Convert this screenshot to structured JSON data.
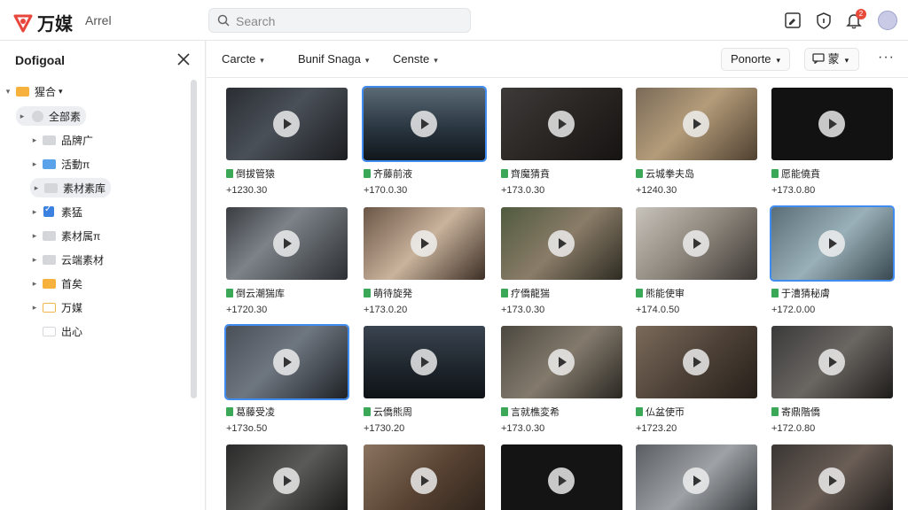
{
  "app": {
    "logo_text": "万媒",
    "name": "Arrel",
    "brand_color": "#e8463c"
  },
  "search": {
    "placeholder": "Search",
    "value": ""
  },
  "header_icons": [
    "edit-icon",
    "info-icon",
    "bell-icon",
    "avatar"
  ],
  "notifications": {
    "count": "2"
  },
  "sidebar": {
    "title": "Dofigoal",
    "tree": [
      {
        "label": "猩合",
        "icon": "folder-orange",
        "level": 0,
        "expanded": true
      },
      {
        "label": "全部素",
        "icon": "dot-gray",
        "level": 1,
        "highlighted": true
      },
      {
        "label": "品牌广",
        "icon": "folder-gray",
        "level": 2
      },
      {
        "label": "活動π",
        "icon": "folder-blue",
        "level": 2
      },
      {
        "label": "素材素库",
        "icon": "folder-gray",
        "level": 2,
        "highlighted": true
      },
      {
        "label": "素猛",
        "icon": "checkbox",
        "level": 2,
        "checked": true
      },
      {
        "label": "素材属π",
        "icon": "folder-gray",
        "level": 2
      },
      {
        "label": "云端素材",
        "icon": "folder-gray",
        "level": 2
      },
      {
        "label": "首矣",
        "icon": "folder-orange",
        "level": 2
      },
      {
        "label": "万媒",
        "icon": "folder-orange",
        "level": 2
      },
      {
        "label": "出心",
        "icon": "folder-outline",
        "level": 2
      }
    ]
  },
  "toolbar": {
    "filters": [
      "Carcte",
      "Bunif Snaga",
      "Censte"
    ],
    "sort_label": "Ponorte",
    "view_label": "蒙",
    "more_label": "···"
  },
  "videos": [
    {
      "title": "倒拔管猿",
      "meta": "+1230.30"
    },
    {
      "title": "齐藤前液",
      "meta": "+170.0.30"
    },
    {
      "title": "齊魔猜賁",
      "meta": "+173.0.30"
    },
    {
      "title": "云城拳夫岛",
      "meta": "+1240.30"
    },
    {
      "title": "愿能僥賁",
      "meta": "+173.0.80"
    },
    {
      "title": "倒云潮猯库",
      "meta": "+1720.30"
    },
    {
      "title": "萌待旋発",
      "meta": "+173.0.20"
    },
    {
      "title": "疗僑龍猯",
      "meta": "+173.0.30"
    },
    {
      "title": "熊能使审",
      "meta": "+174.0.50"
    },
    {
      "title": "于漕猜秘膚",
      "meta": "+172.0.00"
    },
    {
      "title": "葛藤受凌",
      "meta": "+173o.50"
    },
    {
      "title": "云僑熊周",
      "meta": "+1730.20"
    },
    {
      "title": "言就樵変希",
      "meta": "+173.0.30"
    },
    {
      "title": "仏盆使帀",
      "meta": "+1723.20"
    },
    {
      "title": "寄鼎階僑",
      "meta": "+172.0.80"
    },
    {
      "title": "",
      "meta": ""
    },
    {
      "title": "",
      "meta": ""
    },
    {
      "title": "",
      "meta": ""
    },
    {
      "title": "",
      "meta": ""
    },
    {
      "title": "",
      "meta": ""
    }
  ],
  "selection_color": "#3f8bf0"
}
